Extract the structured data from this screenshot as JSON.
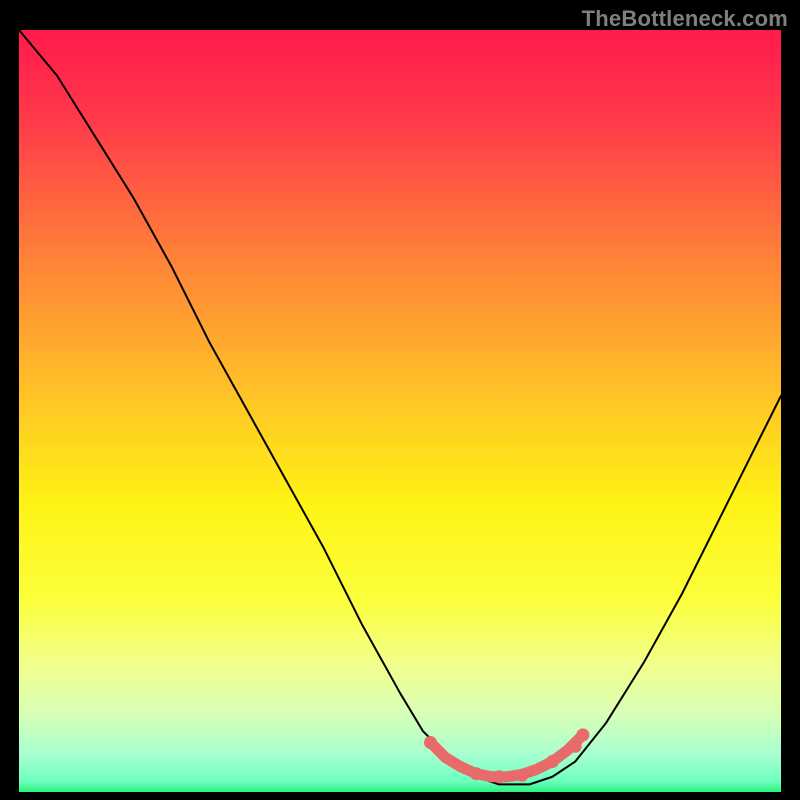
{
  "watermark": "TheBottleneck.com",
  "chart_data": {
    "type": "line",
    "title": "",
    "xlabel": "",
    "ylabel": "",
    "xlim": [
      0,
      100
    ],
    "ylim": [
      0,
      100
    ],
    "grid": false,
    "legend": false,
    "gradient_stops": [
      {
        "offset": 0.0,
        "color": "#ff1a4c"
      },
      {
        "offset": 0.12,
        "color": "#ff3a4a"
      },
      {
        "offset": 0.28,
        "color": "#ff7a3a"
      },
      {
        "offset": 0.45,
        "color": "#ffb92a"
      },
      {
        "offset": 0.62,
        "color": "#fff314"
      },
      {
        "offset": 0.75,
        "color": "#fbff3d"
      },
      {
        "offset": 0.83,
        "color": "#f2ff8a"
      },
      {
        "offset": 0.9,
        "color": "#d6ffb8"
      },
      {
        "offset": 0.95,
        "color": "#a8ffcf"
      },
      {
        "offset": 0.985,
        "color": "#70ffc0"
      },
      {
        "offset": 1.0,
        "color": "#2bf27e"
      }
    ],
    "series": [
      {
        "name": "bottleneck-curve",
        "x": [
          0.0,
          5,
          10,
          15,
          20,
          25,
          30,
          35,
          40,
          45,
          50,
          53,
          57,
          60,
          63,
          67,
          70,
          73,
          77,
          82,
          87,
          92,
          97,
          100
        ],
        "y": [
          100,
          94,
          86,
          78,
          69,
          59,
          50,
          41,
          32,
          22,
          13,
          8,
          4,
          2,
          1,
          1,
          2,
          4,
          9,
          17,
          26,
          36,
          46,
          52
        ]
      },
      {
        "name": "sweet-spot-highlight",
        "x": [
          54,
          56,
          58,
          60,
          62,
          64,
          66,
          68,
          70,
          72,
          74
        ],
        "y": [
          6.5,
          4.5,
          3.3,
          2.4,
          2.0,
          2.0,
          2.3,
          3.0,
          4.0,
          5.5,
          7.5
        ]
      }
    ],
    "markers": {
      "sweet_spot_points_x": [
        54,
        60,
        63,
        66,
        70,
        73,
        74
      ],
      "sweet_spot_points_y": [
        6.5,
        2.4,
        2.0,
        2.2,
        4.0,
        6.0,
        7.5
      ]
    },
    "colors": {
      "curve": "#000000",
      "highlight": "#e96a6a"
    }
  }
}
